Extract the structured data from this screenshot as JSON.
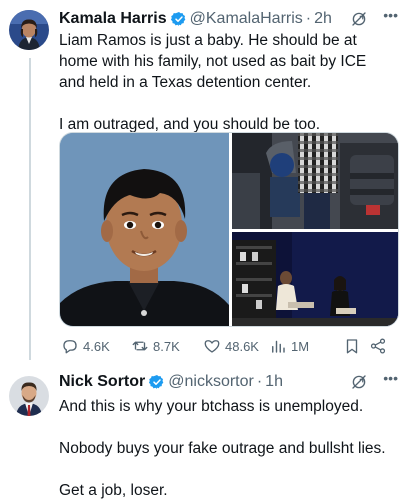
{
  "tweets": [
    {
      "name": "Kamala Harris",
      "handle": "@KamalaHarris",
      "time": "2h",
      "text": "Liam Ramos is just a baby. He should be at home with his family, not used as bait by ICE and held in a Texas detention center.\n\nI am outraged, and you should be too.",
      "stats": {
        "replies": "4.6K",
        "reposts": "8.7K",
        "likes": "48.6K",
        "views": "1M"
      }
    },
    {
      "name": "Nick Sortor",
      "handle": "@nicksortor",
      "time": "1h",
      "text": "And this is why your btchass is unemployed.\n\nNobody buys your fake outrage and bullsht lies.\n\nGet a job, loser."
    }
  ],
  "meta": {
    "separator": "·",
    "more": "•••"
  },
  "colors": {
    "verified": "#1d9bf0",
    "text": "#0f1419",
    "secondary": "#536471",
    "divider": "#cfd9de"
  },
  "icons": [
    "verified-badge-icon",
    "grok-icon",
    "more-icon",
    "reply-icon",
    "repost-icon",
    "like-icon",
    "views-icon",
    "bookmark-icon",
    "share-icon"
  ]
}
